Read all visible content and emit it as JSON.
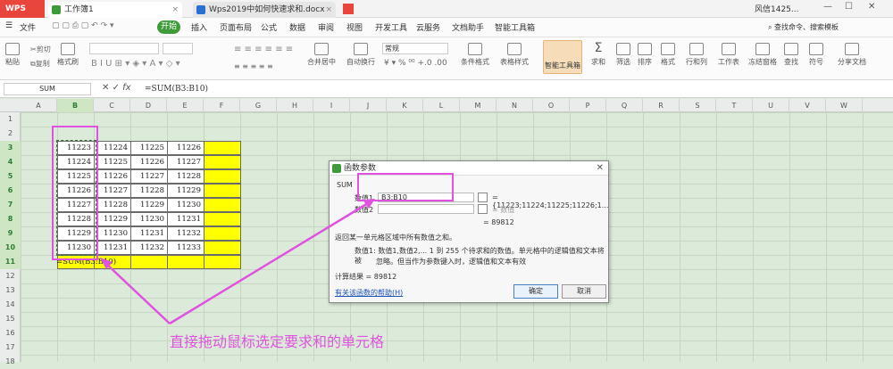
{
  "titlebar": {
    "logo": "WPS",
    "tab1": "工作簿1",
    "tab2": "Wps2019中如何快速求和.docx",
    "user": "风信1425..."
  },
  "menu": {
    "file": "文件",
    "start": "开始",
    "items": [
      "插入",
      "页面布局",
      "公式",
      "数据",
      "审阅",
      "视图",
      "开发工具",
      "云服务",
      "文档助手",
      "智能工具箱"
    ],
    "search": "查找命令、搜索模板"
  },
  "toolbar": {
    "paste": "粘贴",
    "cut": "剪切",
    "copy": "复制",
    "format_painter": "格式刷",
    "merge_center": "合并居中",
    "auto_wrap": "自动换行",
    "number_format": "常规",
    "cond_format": "条件格式",
    "table_style": "表格样式",
    "smart_toolbox": "智能工具箱",
    "sum": "求和",
    "filter": "筛选",
    "sort": "排序",
    "format": "格式",
    "rowcol": "行和列",
    "sheet": "工作表",
    "freeze": "冻结窗格",
    "find": "查找",
    "symbol": "符号",
    "share": "分享文档"
  },
  "formula_bar": {
    "name_box": "SUM",
    "formula": "=SUM(B3:B10)"
  },
  "sheet": {
    "columns": [
      "A",
      "B",
      "C",
      "D",
      "E",
      "F",
      "G",
      "H",
      "I",
      "J",
      "K",
      "L",
      "M",
      "N",
      "O",
      "P",
      "Q",
      "R",
      "S",
      "T",
      "U",
      "V",
      "W"
    ],
    "rows": [
      "1",
      "2",
      "3",
      "4",
      "5",
      "6",
      "7",
      "8",
      "9",
      "10",
      "11",
      "12",
      "13",
      "14",
      "15",
      "16",
      "17",
      "18"
    ],
    "table": [
      [
        "11223",
        "11224",
        "11225",
        "11226"
      ],
      [
        "11224",
        "11225",
        "11226",
        "11227"
      ],
      [
        "11225",
        "11226",
        "11227",
        "11228"
      ],
      [
        "11226",
        "11227",
        "11228",
        "11229"
      ],
      [
        "11227",
        "11228",
        "11229",
        "11230"
      ],
      [
        "11228",
        "11229",
        "11230",
        "11231"
      ],
      [
        "11229",
        "11230",
        "11231",
        "11232"
      ],
      [
        "11230",
        "11231",
        "11232",
        "11233"
      ]
    ],
    "formula_cell": "=SUM(B3:B10)"
  },
  "dialog": {
    "title": "函数参数",
    "func": "SUM",
    "arg1_label": "数值1",
    "arg1_value": "B3:B10",
    "arg1_preview": "= {11223;11224;11225;11226;1...",
    "arg2_label": "数值2",
    "arg2_preview": "= 数值",
    "result_preview": "= 89812",
    "desc": "返回某一单元格区域中所有数值之和。",
    "arg_desc1": "数值1:  数值1,数值2,... 1 到 255 个待求和的数值。单元格中的逻辑值和文本将被",
    "arg_desc2": "忽略。但当作为参数键入时，逻辑值和文本有效",
    "calc_result": "计算结果 = 89812",
    "help_link": "有关该函数的帮助(H)",
    "ok": "确定",
    "cancel": "取消"
  },
  "annotation": "直接拖动鼠标选定要求和的单元格",
  "colors": {
    "accent": "#3f9b3a",
    "annotation": "#e052e0",
    "highlight": "#ffff00"
  }
}
